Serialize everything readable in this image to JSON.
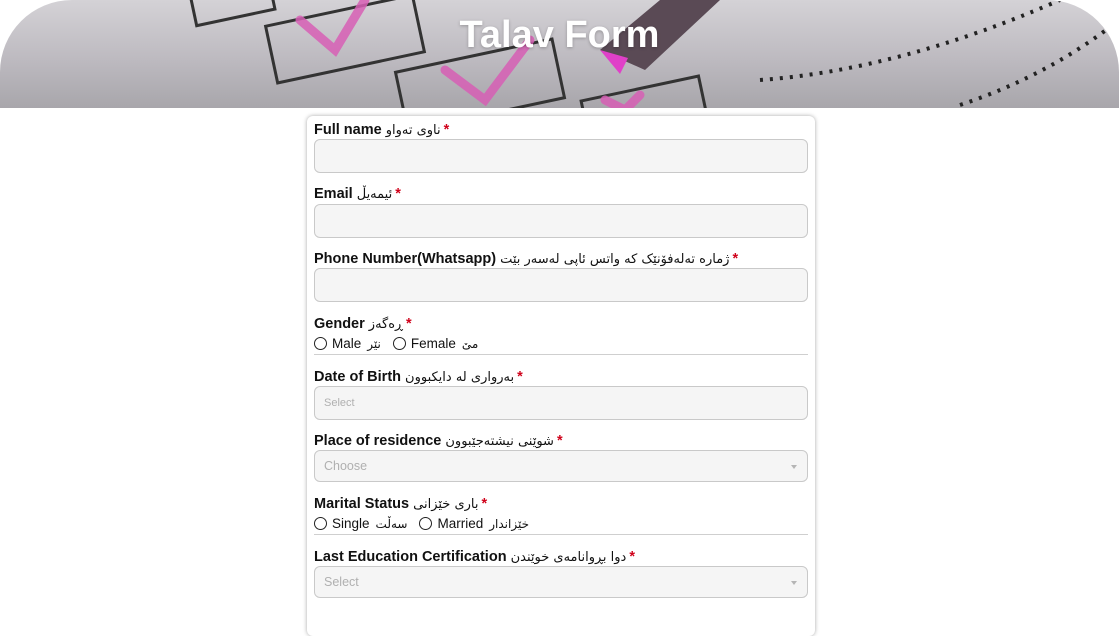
{
  "header": {
    "title": "Talav Form"
  },
  "form": {
    "full_name": {
      "label": "Full name",
      "label_ku": "ناوی تەواو",
      "required": "*"
    },
    "email": {
      "label": "Email",
      "label_ku": "ئیمەیڵ",
      "required": "*"
    },
    "phone": {
      "label": "Phone Number(Whatsapp)",
      "label_ku": "ژمارە تەلەفۆنێک کە واتس ئاپی لەسەر بێت",
      "required": "*"
    },
    "gender": {
      "label": "Gender",
      "label_ku": "ڕەگەز",
      "required": "*",
      "options": [
        {
          "label": "Male",
          "label_ku": "نێر"
        },
        {
          "label": "Female",
          "label_ku": "مێ"
        }
      ]
    },
    "dob": {
      "label": "Date of Birth",
      "label_ku": "بەرواری لە دایکبوون",
      "required": "*",
      "placeholder": "Select"
    },
    "residence": {
      "label": "Place of residence",
      "label_ku": "شوێنی نیشتەجێبوون",
      "required": "*",
      "placeholder": "Choose"
    },
    "marital": {
      "label": "Marital Status",
      "label_ku": "باری خێزانی",
      "required": "*",
      "options": [
        {
          "label": "Single",
          "label_ku": "سەڵت"
        },
        {
          "label": "Married",
          "label_ku": "خێزاندار"
        }
      ]
    },
    "education": {
      "label": "Last Education Certification",
      "label_ku": "دوا بڕوانامەی خوێندن",
      "required": "*",
      "placeholder": "Select"
    }
  },
  "colors": {
    "required": "#d0021b",
    "field_bg": "#f5f5f5",
    "border": "#c9c9c9"
  }
}
